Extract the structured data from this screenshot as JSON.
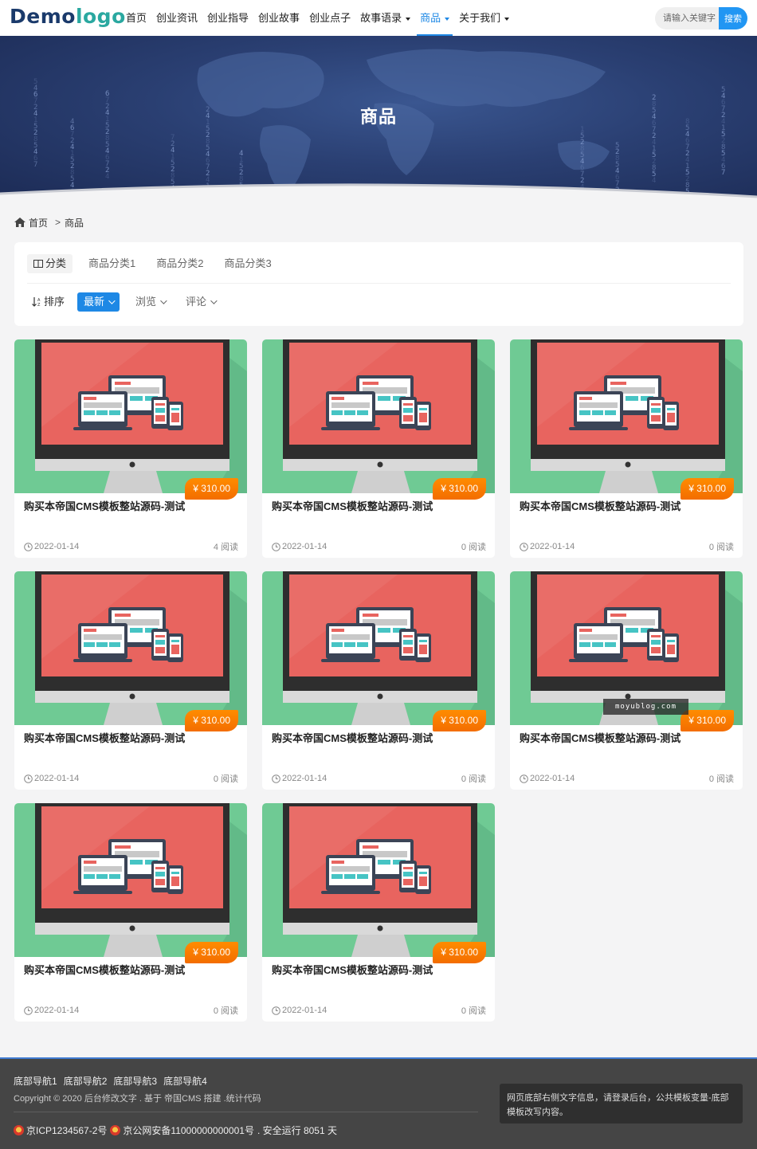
{
  "header": {
    "logo_part1": "Demo",
    "logo_part2": "logo",
    "nav": [
      {
        "label": "首页",
        "dropdown": false,
        "active": false
      },
      {
        "label": "创业资讯",
        "dropdown": false,
        "active": false
      },
      {
        "label": "创业指导",
        "dropdown": false,
        "active": false
      },
      {
        "label": "创业故事",
        "dropdown": false,
        "active": false
      },
      {
        "label": "创业点子",
        "dropdown": false,
        "active": false
      },
      {
        "label": "故事语录",
        "dropdown": true,
        "active": false
      },
      {
        "label": "商品",
        "dropdown": true,
        "active": true
      },
      {
        "label": "关于我们",
        "dropdown": true,
        "active": false
      }
    ],
    "search_placeholder": "请输入关键字",
    "search_button": "搜索"
  },
  "banner": {
    "title": "商品",
    "digits": [
      "5",
      "4",
      "6",
      "7",
      "2",
      "4",
      "1",
      "5",
      "2",
      "8"
    ]
  },
  "breadcrumb": {
    "home": "首页",
    "separator": ">",
    "current": "商品",
    "home_icon": "home-icon"
  },
  "filter": {
    "category_label": "分类",
    "categories": [
      "商品分类1",
      "商品分类2",
      "商品分类3"
    ],
    "sort_label": "排序",
    "sort_active": "最新",
    "sort_options": [
      "浏览",
      "评论"
    ]
  },
  "products": [
    {
      "price": "¥ 310.00",
      "title": "购买本帝国CMS模板整站源码-测试",
      "date": "2022-01-14",
      "reads": "4 阅读"
    },
    {
      "price": "¥ 310.00",
      "title": "购买本帝国CMS模板整站源码-测试",
      "date": "2022-01-14",
      "reads": "0 阅读"
    },
    {
      "price": "¥ 310.00",
      "title": "购买本帝国CMS模板整站源码-测试",
      "date": "2022-01-14",
      "reads": "0 阅读"
    },
    {
      "price": "¥ 310.00",
      "title": "购买本帝国CMS模板整站源码-测试",
      "date": "2022-01-14",
      "reads": "0 阅读"
    },
    {
      "price": "¥ 310.00",
      "title": "购买本帝国CMS模板整站源码-测试",
      "date": "2022-01-14",
      "reads": "0 阅读"
    },
    {
      "price": "¥ 310.00",
      "title": "购买本帝国CMS模板整站源码-测试",
      "date": "2022-01-14",
      "reads": "0 阅读"
    },
    {
      "price": "¥ 310.00",
      "title": "购买本帝国CMS模板整站源码-测试",
      "date": "2022-01-14",
      "reads": "0 阅读"
    },
    {
      "price": "¥ 310.00",
      "title": "购买本帝国CMS模板整站源码-测试",
      "date": "2022-01-14",
      "reads": "0 阅读"
    }
  ],
  "watermark": "moyublog.com",
  "footer": {
    "nav": [
      "底部导航1",
      "底部导航2",
      "底部导航3",
      "底部导航4"
    ],
    "copyright": "Copyright © 2020 后台修改文字 . 基于 帝国CMS 搭建 .统计代码",
    "icp": "京ICP1234567-2号",
    "police": "京公网安备11000000000001号",
    "uptime": ". 安全运行 8051 天",
    "side_text": "网页底部右侧文字信息，请登录后台，公共模板变量-底部模板改写内容。"
  },
  "colors": {
    "accent": "#1e88e5",
    "price": "#f57c00",
    "footer_bg": "#454545",
    "banner": "#2a3f72"
  }
}
